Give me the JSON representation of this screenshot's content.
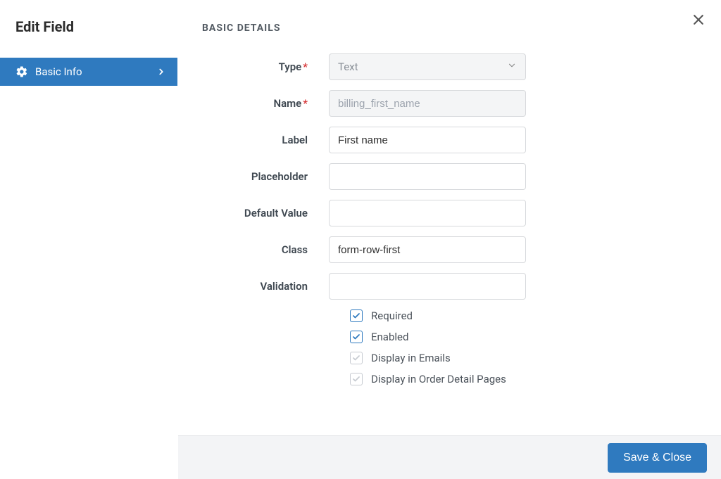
{
  "page": {
    "title": "Edit Field"
  },
  "sidebar": {
    "items": [
      {
        "label": "Basic Info",
        "icon": "gear-icon"
      }
    ]
  },
  "section": {
    "header": "BASIC DETAILS"
  },
  "form": {
    "type": {
      "label": "Type",
      "required": true,
      "value": "Text",
      "disabled": true
    },
    "name": {
      "label": "Name",
      "required": true,
      "value": "",
      "placeholder": "billing_first_name",
      "disabled": true
    },
    "labelField": {
      "label": "Label",
      "value": "First name"
    },
    "placeholder": {
      "label": "Placeholder",
      "value": ""
    },
    "defaultValue": {
      "label": "Default Value",
      "value": ""
    },
    "class": {
      "label": "Class",
      "value": "form-row-first"
    },
    "validation": {
      "label": "Validation",
      "value": ""
    },
    "checkboxes": {
      "required": {
        "label": "Required",
        "checked": true,
        "locked": false
      },
      "enabled": {
        "label": "Enabled",
        "checked": true,
        "locked": false
      },
      "displayEmails": {
        "label": "Display in Emails",
        "checked": true,
        "locked": true
      },
      "displayOrder": {
        "label": "Display in Order Detail Pages",
        "checked": true,
        "locked": true
      }
    }
  },
  "footer": {
    "save_label": "Save & Close"
  }
}
